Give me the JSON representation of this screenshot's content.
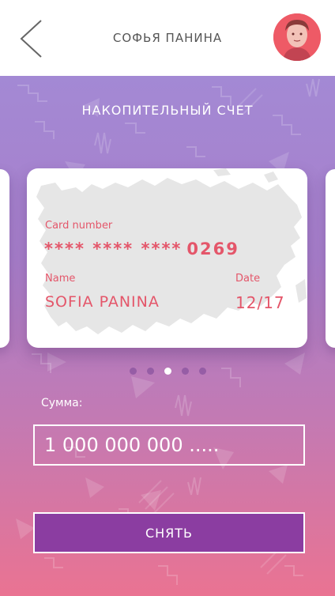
{
  "header": {
    "user_name": "СОФЬЯ ПАНИНА"
  },
  "account": {
    "title": "НАКОПИТЕЛЬНЫЙ СЧЕТ"
  },
  "card": {
    "number_label": "Card number",
    "number_masked": "**** **** ****",
    "number_last": "0269",
    "name_label": "Name",
    "name": "SOFIA PANINA",
    "date_label": "Date",
    "date": "12/17"
  },
  "carousel": {
    "count": 5,
    "active_index": 2
  },
  "amount": {
    "label": "Сумма:",
    "value": "1 000 000 000 ....."
  },
  "actions": {
    "withdraw_label": "СНЯТЬ"
  },
  "colors": {
    "accent": "#e4566a",
    "button": "#8b3da1",
    "avatar_bg": "#ee5a66"
  }
}
